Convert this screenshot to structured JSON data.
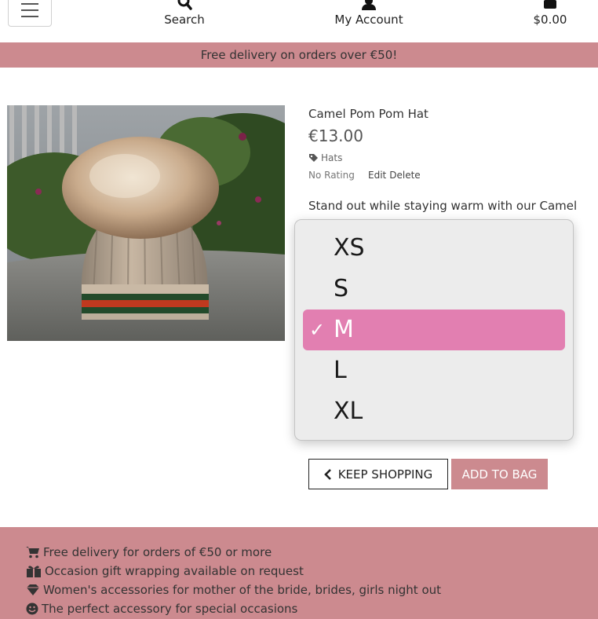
{
  "nav": {
    "search_label": "Search",
    "account_label": "My Account",
    "bag_total": "$0.00"
  },
  "banner": {
    "text": "Free delivery on orders over €50!"
  },
  "product": {
    "name": "Camel Pom Pom Hat",
    "price": "€13.00",
    "category": "Hats",
    "rating": "No Rating",
    "edit_label": "Edit",
    "delete_label": "Delete",
    "description": "Stand out while staying warm with our Camel"
  },
  "size_dropdown": {
    "options": [
      "XS",
      "S",
      "M",
      "L",
      "XL"
    ],
    "selected": "M",
    "highlight_color": "#e27fb1"
  },
  "actions": {
    "keep_shopping_label": "KEEP SHOPPING",
    "add_to_bag_label": "ADD TO BAG"
  },
  "footer": {
    "items": [
      "Free delivery for orders of €50 or more",
      "Occasion gift wrapping available on request",
      "Women's accessories for mother of the bride, brides, girls night out",
      "The perfect accessory for special occasions"
    ],
    "icons": [
      "cart-icon",
      "gift-icon",
      "gem-icon",
      "smile-icon"
    ]
  },
  "colors": {
    "brand_pink": "#cc8a8f"
  }
}
